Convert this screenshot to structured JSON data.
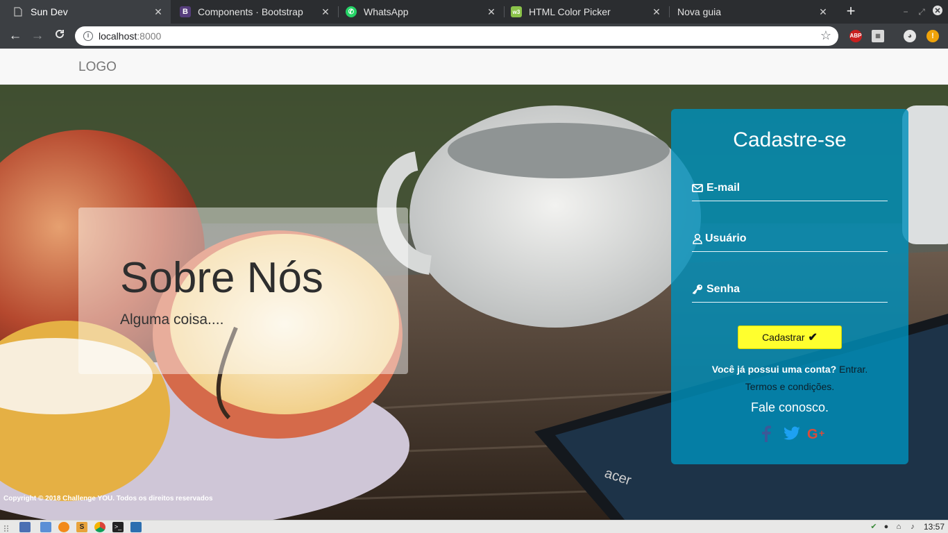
{
  "browser": {
    "tabs": [
      {
        "title": "Sun Dev",
        "favicon": "page-icon",
        "active": true
      },
      {
        "title": "Components · Bootstrap",
        "favicon": "bootstrap-icon",
        "active": false
      },
      {
        "title": "WhatsApp",
        "favicon": "whatsapp-icon",
        "active": false
      },
      {
        "title": "HTML Color Picker",
        "favicon": "color-picker-icon",
        "active": false
      },
      {
        "title": "Nova guia",
        "favicon": "none",
        "active": false
      }
    ],
    "url_host": "localhost",
    "url_port": ":8000"
  },
  "site": {
    "logo": "LOGO",
    "about": {
      "title": "Sobre Nós",
      "subtitle": "Alguma coisa...."
    },
    "copyright": "Copyright © 2018 Challenge YOU. Todos os direitos reservados"
  },
  "signup": {
    "title": "Cadastre-se",
    "fields": [
      {
        "label": "E-mail",
        "icon": "envelope-icon"
      },
      {
        "label": "Usuário",
        "icon": "user-icon"
      },
      {
        "label": "Senha",
        "icon": "key-icon"
      }
    ],
    "submit_label": "Cadastrar",
    "submit_icon": "check-icon",
    "have_account": "Você já possui uma conta?",
    "login_link": "Entrar.",
    "terms": "Termos e condições.",
    "contact": "Fale conosco.",
    "social": [
      "facebook-icon",
      "twitter-icon",
      "google-plus-icon"
    ],
    "colors": {
      "panel": "#008fba",
      "button": "#ffff2e",
      "facebook": "#3b5998",
      "twitter": "#1da1f2",
      "google": "#dd4b39"
    }
  },
  "taskbar": {
    "clock": "13:57"
  }
}
